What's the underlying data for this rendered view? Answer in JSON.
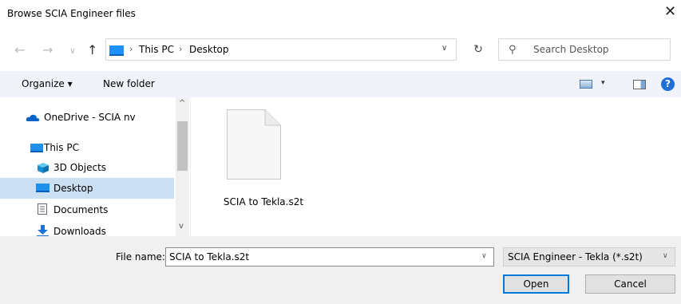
{
  "window": {
    "title": "Browse SCIA Engineer files",
    "close_icon": "close-icon"
  },
  "nav": {
    "back_icon": "←",
    "forward_icon": "→",
    "recent_icon": "∨",
    "up_icon": "↑",
    "breadcrumb": [
      "This PC",
      "Desktop"
    ],
    "breadcrumb_sep": "›",
    "address_dropdown_icon": "∨",
    "refresh_icon": "↻",
    "search_placeholder": "Search Desktop",
    "search_icon": "⚲"
  },
  "commandbar": {
    "organize_label": "Organize ▾",
    "new_folder_label": "New folder",
    "view_dropdown_icon": "▾",
    "help_icon": "?"
  },
  "navpane": {
    "items": [
      {
        "label": "OneDrive - SCIA nv",
        "icon": "cloud-icon"
      },
      {
        "label": "This PC",
        "icon": "pc-icon"
      },
      {
        "label": "3D Objects",
        "icon": "cube-icon"
      },
      {
        "label": "Desktop",
        "icon": "desktop-icon",
        "selected": true
      },
      {
        "label": "Documents",
        "icon": "document-icon"
      },
      {
        "label": "Downloads",
        "icon": "download-icon"
      }
    ],
    "scroll_up": "^",
    "scroll_down": "v"
  },
  "files": [
    {
      "name": "SCIA to Tekla.s2t",
      "icon": "file-icon"
    }
  ],
  "footer": {
    "file_name_label": "File name:",
    "file_name_value": "SCIA to Tekla.s2t",
    "file_type_value": "SCIA Engineer - Tekla (*.s2t)",
    "dropdown_icon": "∨",
    "open_label": "Open",
    "cancel_label": "Cancel"
  }
}
